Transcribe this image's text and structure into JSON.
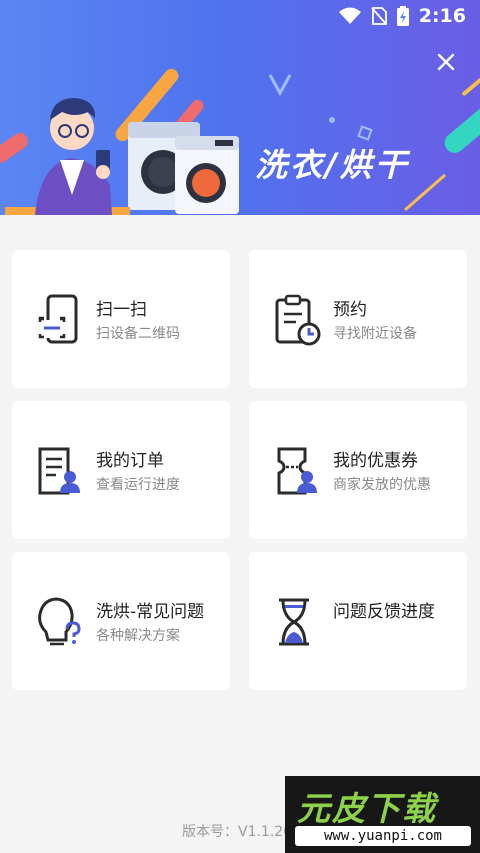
{
  "status_bar": {
    "time": "2:16",
    "icons": [
      "wifi-icon",
      "no-sim-icon",
      "battery-charging-icon"
    ]
  },
  "header": {
    "banner_title": "洗衣/烘干",
    "close_icon": "close-icon"
  },
  "menu": [
    {
      "title": "扫一扫",
      "subtitle": "扫设备二维码",
      "icon": "scan-phone-icon"
    },
    {
      "title": "预约",
      "subtitle": "寻找附近设备",
      "icon": "appointment-clipboard-icon"
    },
    {
      "title": "我的订单",
      "subtitle": "查看运行进度",
      "icon": "order-document-icon"
    },
    {
      "title": "我的优惠券",
      "subtitle": "商家发放的优惠",
      "icon": "coupon-icon"
    },
    {
      "title": "洗烘-常见问题",
      "subtitle": "各种解决方案",
      "icon": "faq-lightbulb-icon"
    },
    {
      "title": "问题反馈进度",
      "subtitle": "",
      "icon": "hourglass-icon"
    }
  ],
  "footer": {
    "version": "版本号：V1.1.20"
  },
  "watermark": {
    "brand": "元皮下载",
    "url": "www.yuanpi.com"
  },
  "colors": {
    "header_start": "#5b86f2",
    "header_end": "#6a5ee6",
    "icon_accent": "#4a5bd4",
    "icon_dark": "#2b2b2b"
  }
}
